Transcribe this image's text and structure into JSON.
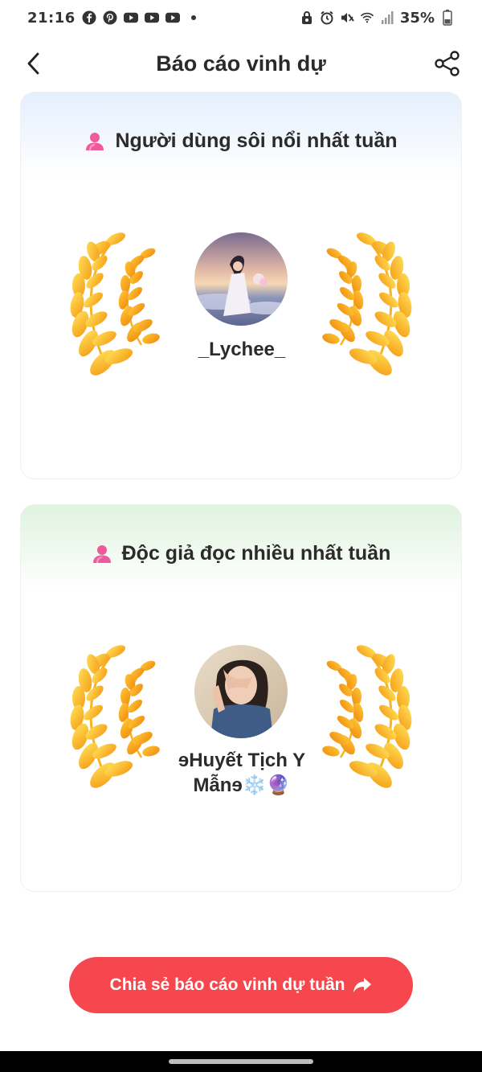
{
  "status_bar": {
    "time": "21:16",
    "battery": "35%",
    "left_icons": [
      "facebook-icon",
      "pinterest-icon",
      "youtube-icon",
      "youtube-icon",
      "youtube-icon"
    ],
    "right_icons": [
      "alarm-lock-icon",
      "alarm-icon",
      "mute-icon",
      "wifi-icon",
      "signal-icon",
      "battery-icon"
    ]
  },
  "header": {
    "title": "Báo cáo vinh dự",
    "back_icon": "chevron-left-icon",
    "share_icon": "share-icon"
  },
  "cards": [
    {
      "title": "Người dùng sôi nổi nhất tuần",
      "icon": "user-icon",
      "winner_name": "_Lychee_",
      "accent": "#e4effd"
    },
    {
      "title": "Độc giả đọc nhiều nhất tuần",
      "icon": "user-icon",
      "winner_name": "ɘHuyết Tịch Y Mẫnɘ❄️🔮",
      "accent": "#dff3df"
    }
  ],
  "cta": {
    "label": "Chia sẻ báo cáo vinh dự tuần",
    "icon": "forward-arrow-icon",
    "color": "#f5474d"
  },
  "colors": {
    "laurel_light": "#ffd84a",
    "laurel_dark": "#f59a14",
    "icon_pink": "#ef5a9c"
  }
}
